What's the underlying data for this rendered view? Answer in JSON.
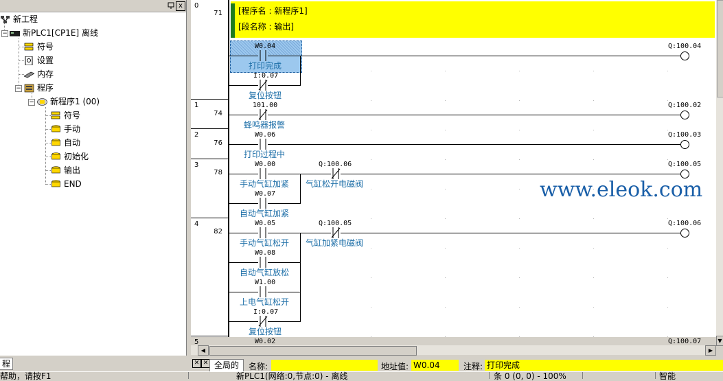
{
  "tree": {
    "close_glyph": "x",
    "root": "新工程",
    "plc": "新PLC1[CP1E] 离线",
    "items": [
      "符号",
      "设置",
      "内存",
      "程序"
    ],
    "program": "新程序1 (00)",
    "sections": [
      "符号",
      "手动",
      "自动",
      "初始化",
      "输出",
      "END"
    ],
    "tab_label": "程"
  },
  "ladder": {
    "program_name_line": "[程序名 : 新程序1]",
    "section_name_line": "[段名称 : 输出]",
    "rungs": [
      {
        "index": "0",
        "step": "71"
      },
      {
        "index": "1",
        "step": "74"
      },
      {
        "index": "2",
        "step": "76"
      },
      {
        "index": "3",
        "step": "78"
      },
      {
        "index": "4",
        "step": "82"
      },
      {
        "index": "5",
        "step": ""
      }
    ],
    "contacts": [
      {
        "addr": "W0.04",
        "comment": "打印完成"
      },
      {
        "addr": "I:0.07",
        "comment": "复位按钮"
      },
      {
        "addr": "101.00",
        "comment": "蜂鸣器报警"
      },
      {
        "addr": "W0.06",
        "comment": "打印过程中"
      },
      {
        "addr": "W0.00",
        "comment": "手动气缸加紧"
      },
      {
        "addr": "Q:100.06",
        "comment": "气缸松开电磁阀"
      },
      {
        "addr": "W0.07",
        "comment": "自动气缸加紧"
      },
      {
        "addr": "W0.05",
        "comment": "手动气缸松开"
      },
      {
        "addr": "Q:100.05",
        "comment": "气缸加紧电磁阀"
      },
      {
        "addr": "W0.08",
        "comment": "自动气缸放松"
      },
      {
        "addr": "W1.00",
        "comment": "上电气缸松开"
      },
      {
        "addr": "I:0.07",
        "comment": "复位按钮"
      },
      {
        "addr": "W0.02",
        "comment": ""
      }
    ],
    "coils": [
      "Q:100.04",
      "Q:100.02",
      "Q:100.03",
      "Q:100.05",
      "Q:100.06",
      "Q:100.07"
    ]
  },
  "watermark": "www.eleok.com",
  "infobar": {
    "global_tab": "全局的",
    "name_label": "名称:",
    "name_value": "",
    "address_label": "地址值:",
    "address_value": "W0.04",
    "comment_label": "注释:",
    "comment_value": "打印完成"
  },
  "statusbar": {
    "help": "帮助，请按F1",
    "network": "新PLC1(网络:0,节点:0) - 离线",
    "position": "条 0 (0, 0) - 100%",
    "mode": "智能"
  },
  "colors": {
    "comment_bg": "#ffff00",
    "comment_text": "#1e6fa8",
    "selection": "#9cc8ee"
  }
}
